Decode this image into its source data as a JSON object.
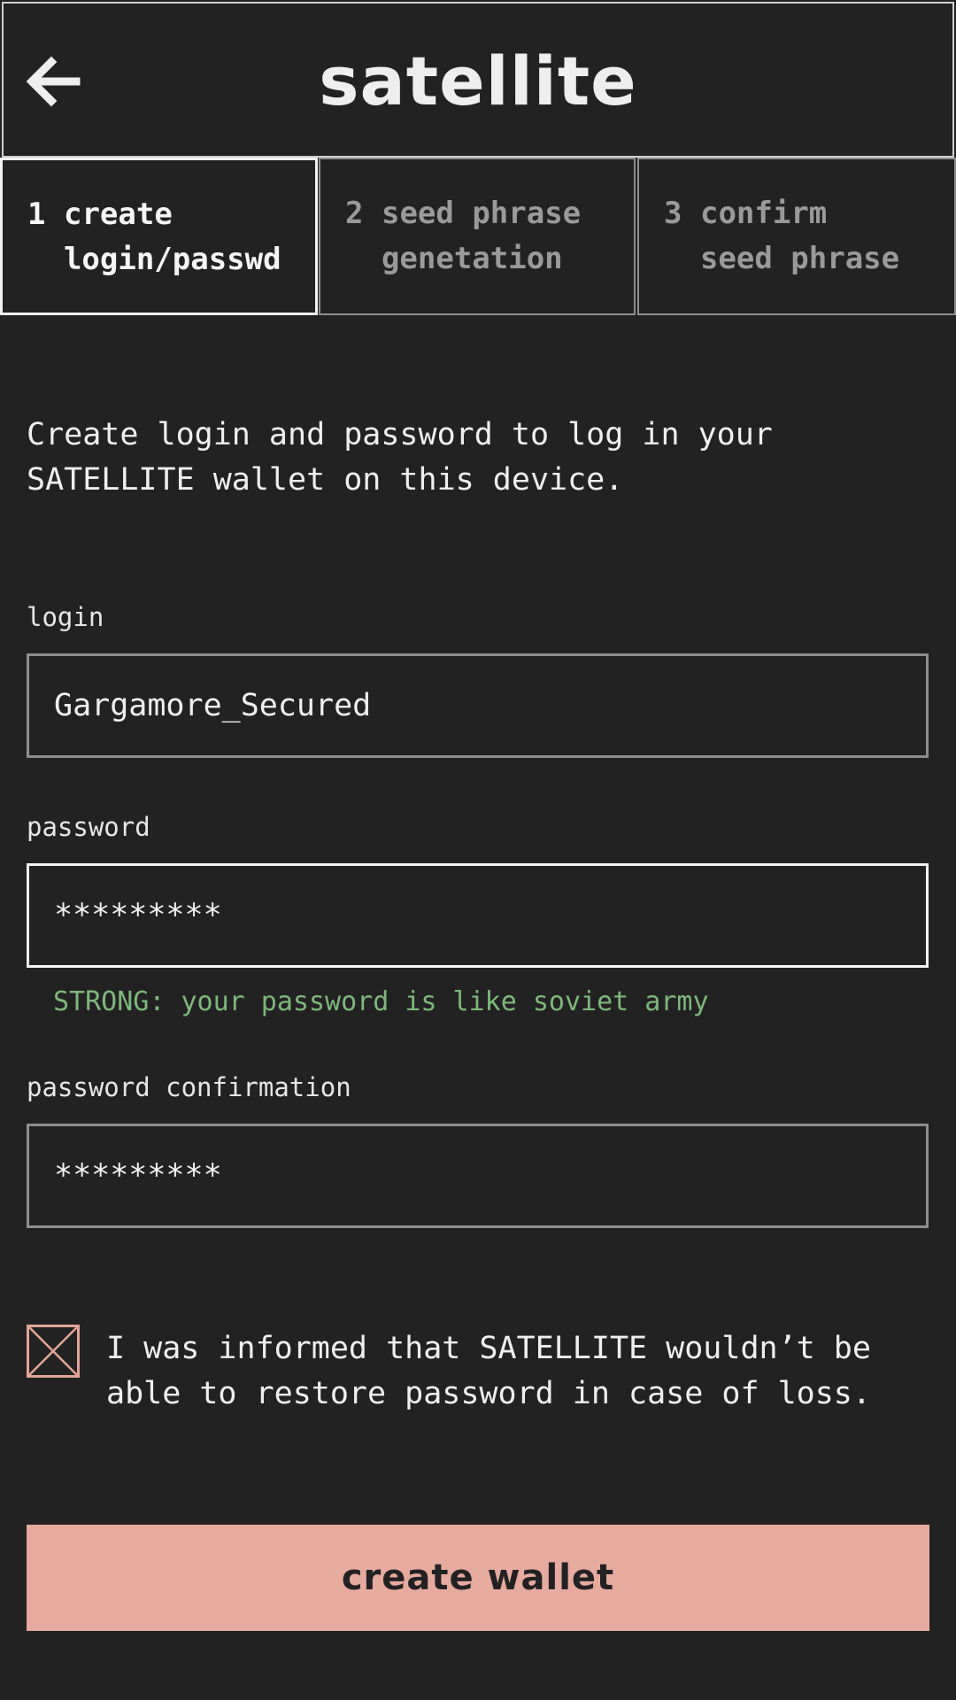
{
  "app": {
    "title": "satellite"
  },
  "steps": [
    {
      "number": "1",
      "line1": "create",
      "line2": "login/passwd",
      "active": true
    },
    {
      "number": "2",
      "line1": "seed phrase",
      "line2": "genetation",
      "active": false
    },
    {
      "number": "3",
      "line1": "confirm",
      "line2": "seed phrase",
      "active": false
    }
  ],
  "intro": {
    "line1": "Create login and password to log in your",
    "line2": "SATELLITE wallet on this device."
  },
  "form": {
    "login": {
      "label": "login",
      "value": "Gargamore_Secured"
    },
    "password": {
      "label": "password",
      "value": "*********",
      "strength": "STRONG: your password is like soviet army"
    },
    "confirm": {
      "label": "password confirmation",
      "value": "*********"
    }
  },
  "disclaimer": {
    "line1": "I was informed that SATELLITE wouldn’t be",
    "line2": "able to restore password in case of loss."
  },
  "actions": {
    "create_label": "create wallet"
  },
  "colors": {
    "background": "#222222",
    "accent": "#e7aa9e",
    "success": "#7db87a",
    "checkbox_border": "#e3a597"
  },
  "icons": {
    "back": "arrow-left-icon",
    "checkbox": "checkbox-cross-icon"
  }
}
